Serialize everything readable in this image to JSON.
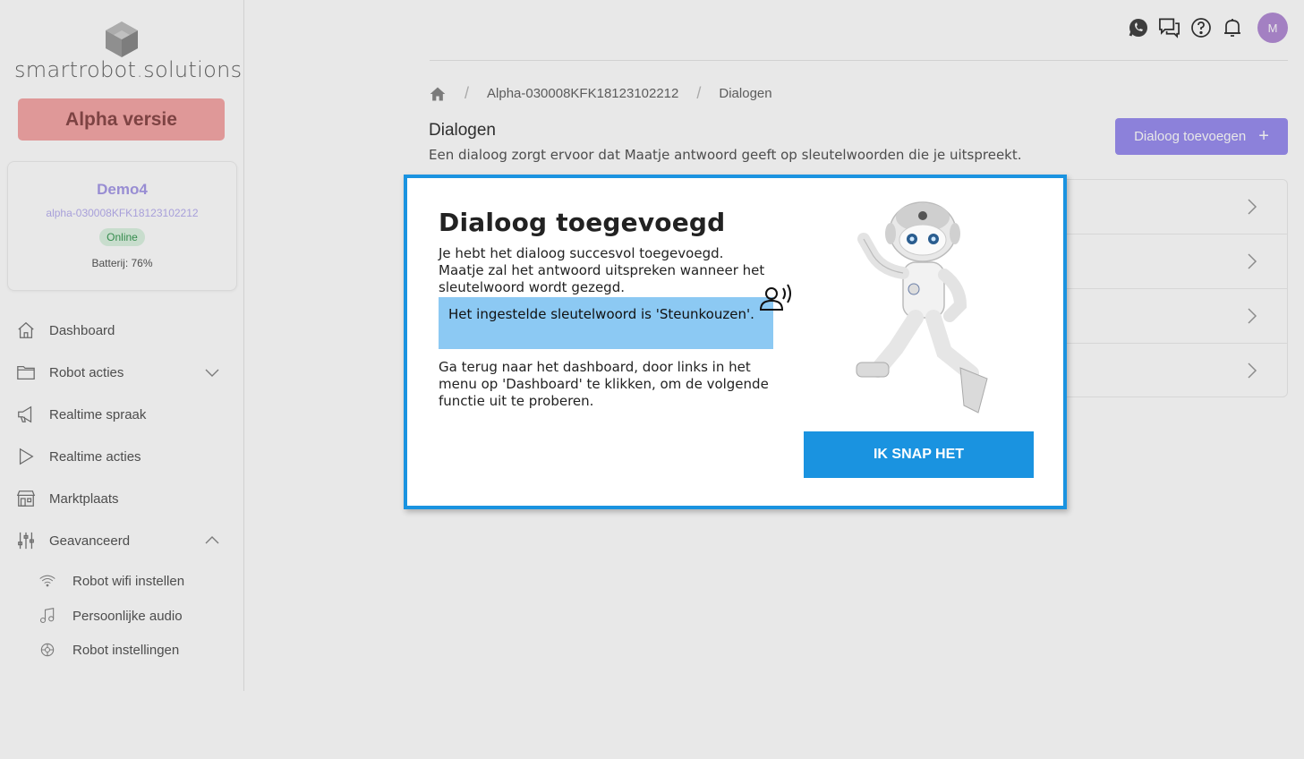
{
  "brand": {
    "logo_text_main": "smartrobot",
    "logo_text_dot": ".",
    "logo_text_suffix": "solutions",
    "alpha_label": "Alpha versie"
  },
  "robot": {
    "name": "Demo4",
    "id": "alpha-030008KFK18123102212",
    "status": "Online",
    "battery": "Batterij: 76%"
  },
  "sidebar": {
    "items": [
      {
        "label": "Dashboard",
        "icon": "home-icon"
      },
      {
        "label": "Robot acties",
        "icon": "folder-icon"
      },
      {
        "label": "Realtime spraak",
        "icon": "megaphone-icon"
      },
      {
        "label": "Realtime acties",
        "icon": "play-icon"
      },
      {
        "label": "Marktplaats",
        "icon": "store-icon"
      },
      {
        "label": "Geavanceerd",
        "icon": "sliders-icon"
      }
    ],
    "sub_items": [
      {
        "label": "Robot wifi instellen",
        "icon": "wifi-icon"
      },
      {
        "label": "Persoonlijke audio",
        "icon": "music-icon"
      },
      {
        "label": "Robot instellingen",
        "icon": "settings-icon"
      }
    ]
  },
  "header": {
    "avatar_initial": "M"
  },
  "breadcrumb": {
    "robot": "Alpha-030008KFK18123102212",
    "current": "Dialogen",
    "sep": "/"
  },
  "page": {
    "title": "Dialogen",
    "subtitle": "Een dialoog zorgt ervoor dat Maatje antwoord geeft op sleutelwoorden die je uitspreekt.",
    "add_button": "Dialoog toevoegen",
    "add_symbol": "+"
  },
  "modal": {
    "title": "Dialoog toegevoegd",
    "text1": "Je hebt het dialoog succesvol toegevoegd. Maatje zal het antwoord uitspreken wanneer het sleutelwoord wordt gezegd.",
    "keyword_text": "Het ingestelde sleutelwoord is 'Steunkouzen'.",
    "text2": "Ga terug naar het dashboard, door links in het menu op 'Dashboard' te klikken, om de volgende functie uit te proberen.",
    "button": "IK SNAP HET"
  },
  "colors": {
    "accent": "#1a93e0",
    "purple": "#9a8ef0",
    "alpha": "#f6a8a8",
    "keyword_bg": "#8cc9f3"
  }
}
